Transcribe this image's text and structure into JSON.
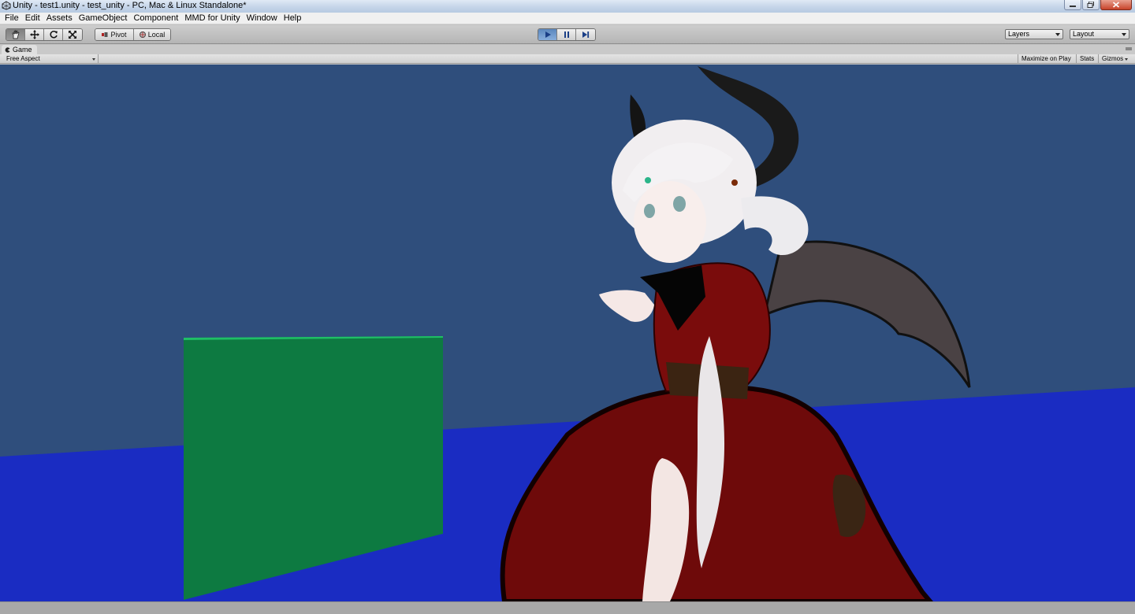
{
  "window": {
    "title": "Unity - test1.unity - test_unity - PC, Mac & Linux Standalone*"
  },
  "menu": {
    "items": [
      "File",
      "Edit",
      "Assets",
      "GameObject",
      "Component",
      "MMD for Unity",
      "Window",
      "Help"
    ]
  },
  "toolbar": {
    "transform_tools": [
      "hand-icon",
      "move-icon",
      "rotate-icon",
      "scale-icon"
    ],
    "pivot_label": "Pivot",
    "local_label": "Local",
    "layers_label": "Layers",
    "layout_label": "Layout"
  },
  "game_panel": {
    "tab_label": "Game",
    "aspect_label": "Free Aspect",
    "maximize_label": "Maximize on Play",
    "stats_label": "Stats",
    "gizmos_label": "Gizmos"
  },
  "colors": {
    "sky": "#2f4e7c",
    "floor": "#1a2cc2",
    "cube_front": "#0d7a41",
    "cube_top": "#1fbf66",
    "dress": "#6e0a0a",
    "hair": "#f1eef0",
    "play_active": "#5b87bd"
  }
}
